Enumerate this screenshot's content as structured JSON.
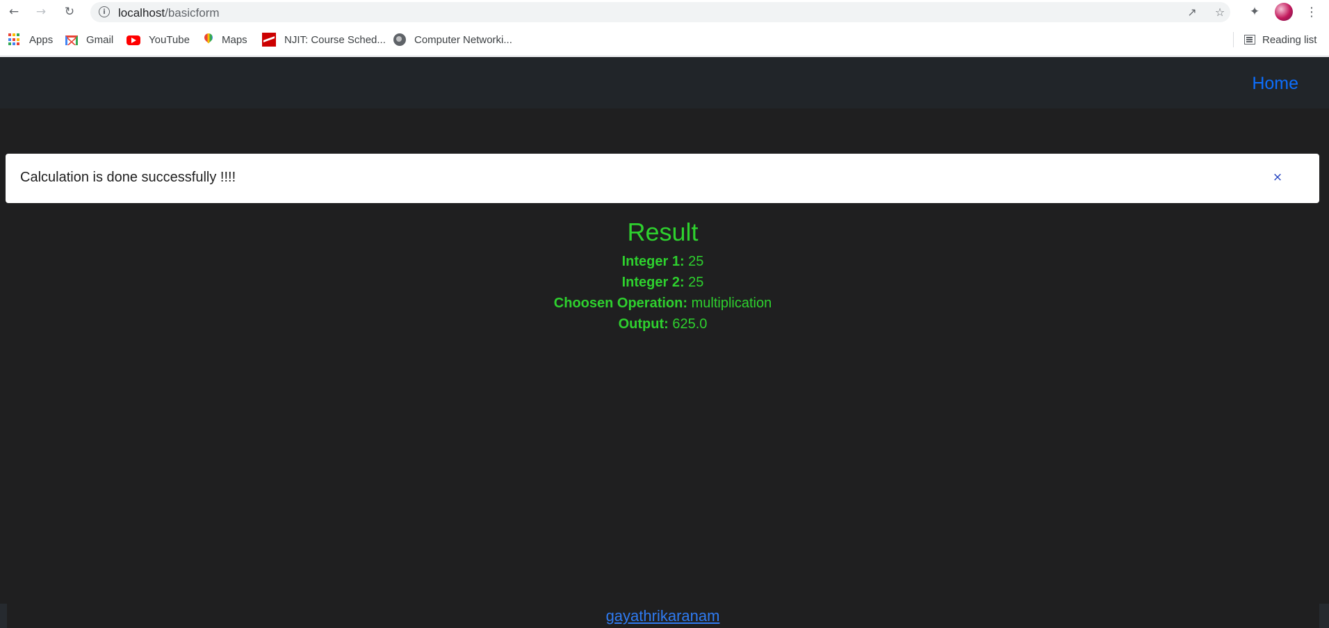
{
  "browser": {
    "url_host": "localhost",
    "url_path": "/basicform",
    "bookmarks": [
      {
        "label": "Apps",
        "icon": "apps-grid-icon"
      },
      {
        "label": "Gmail",
        "icon": "gmail-icon"
      },
      {
        "label": "YouTube",
        "icon": "youtube-icon"
      },
      {
        "label": "Maps",
        "icon": "maps-icon"
      },
      {
        "label": "NJIT: Course Sched...",
        "icon": "njit-icon"
      },
      {
        "label": "Computer Networki...",
        "icon": "globe-icon"
      }
    ],
    "reading_list": "Reading list"
  },
  "navbar": {
    "home_label": "Home",
    "background": "#212529",
    "link_color": "#0d6efd"
  },
  "alert": {
    "message": "Calculation is done successfully !!!!",
    "close_symbol": "×"
  },
  "result": {
    "title": "Result",
    "color": "#2ed12e",
    "rows": [
      {
        "label": "Integer 1:",
        "value": "25"
      },
      {
        "label": "Integer 2:",
        "value": "25"
      },
      {
        "label": "Choosen Operation:",
        "value": "multiplication"
      },
      {
        "label": "Output:",
        "value": "625.0"
      }
    ]
  },
  "footer": {
    "link_text": "gayathrikaranam"
  }
}
